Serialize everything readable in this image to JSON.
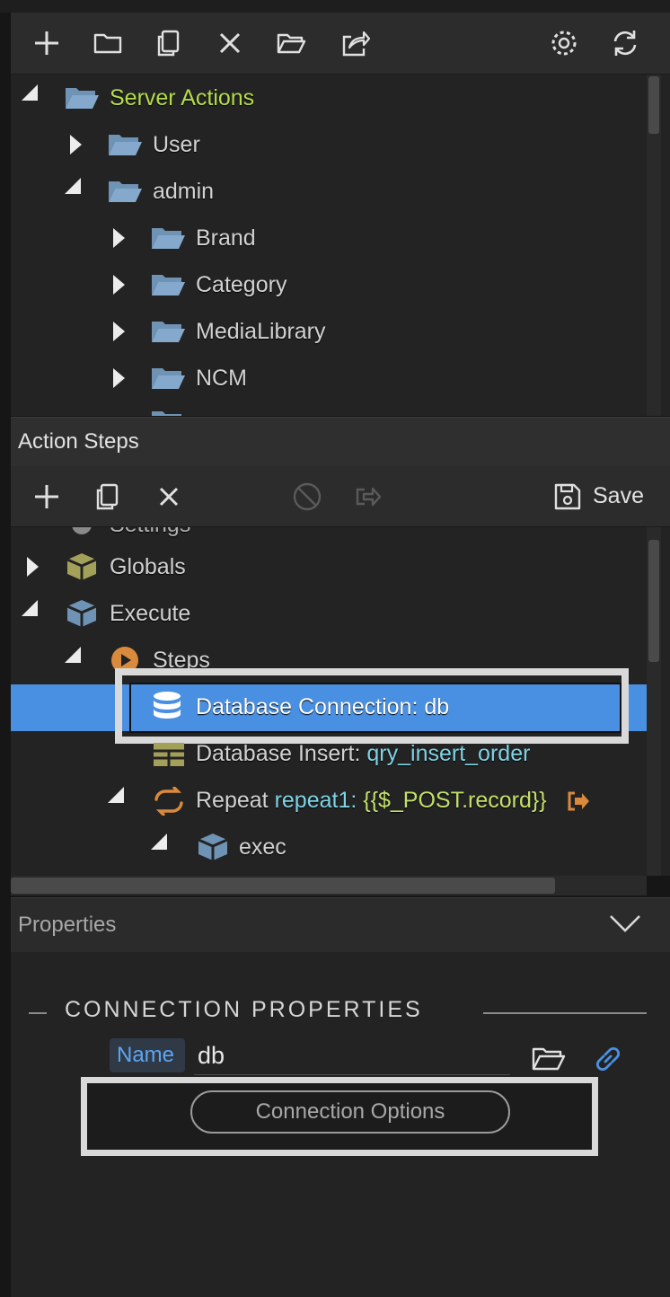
{
  "top_toolbar": {
    "icons": [
      "plus-icon",
      "folder-icon",
      "copy-icon",
      "close-icon",
      "folder-open-icon",
      "share-icon",
      "gear-icon",
      "refresh-icon"
    ]
  },
  "server_tree": {
    "items": [
      {
        "label": "Server Actions",
        "level": 0,
        "expanded": true,
        "highlight": true
      },
      {
        "label": "User",
        "level": 1,
        "expanded": false
      },
      {
        "label": "admin",
        "level": 1,
        "expanded": true
      },
      {
        "label": "Brand",
        "level": 2,
        "expanded": false
      },
      {
        "label": "Category",
        "level": 2,
        "expanded": false
      },
      {
        "label": "MediaLibrary",
        "level": 2,
        "expanded": false
      },
      {
        "label": "NCM",
        "level": 2,
        "expanded": false
      }
    ]
  },
  "action_steps": {
    "title": "Action Steps",
    "save_label": "Save"
  },
  "steps_tree": {
    "partial_top": "Settings",
    "globals": "Globals",
    "execute": "Execute",
    "steps": "Steps",
    "selected": "Database Connection: db",
    "insert_prefix": "Database Insert:",
    "insert_name": "qry_insert_order",
    "repeat_prefix": "Repeat",
    "repeat_name": "repeat1:",
    "repeat_expr": "{{$_POST.record}}",
    "exec": "exec"
  },
  "properties": {
    "title": "Properties",
    "section": "CONNECTION PROPERTIES",
    "name_label": "Name",
    "name_value": "db",
    "options_button": "Connection Options"
  },
  "colors": {
    "selection": "#4a90e2",
    "highlight_green": "#b6dc4a",
    "cyan_text": "#7fd3e6",
    "folder_blue": "#7ea6c8",
    "link_blue": "#4a90e2",
    "orange": "#d98a3d",
    "olive": "#a3a05a"
  }
}
